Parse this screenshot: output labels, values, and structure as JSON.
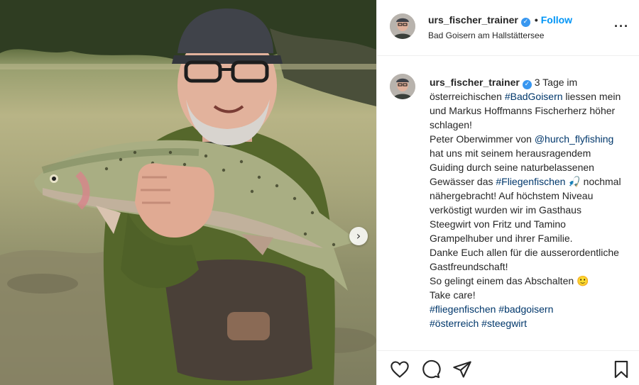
{
  "post": {
    "username": "urs_fischer_trainer",
    "follow_label": "Follow",
    "location": "Bad Goisern am Hallstättersee"
  },
  "caption": {
    "username": "urs_fischer_trainer",
    "line1_text": "3 Tage im österreichischen ",
    "tag1": "#BadGoisern",
    "line1_rest": " liessen mein und Markus Hoffmanns Fischerherz höher schlagen!",
    "line2_text": "Peter Oberwimmer von",
    "mention": "@hurch_flyfishing",
    "line2_rest": " hat uns mit seinem herausragendem Guiding durch seine naturbelassenen Gewässer das",
    "tag2": "#Fliegenfischen",
    "emoji1": "🎣",
    "line3_rest": " nochmal nähergebracht! Auf höchstem Niveau verköstigt wurden wir im Gasthaus Steegwirt von Fritz und Tamino Grampelhuber und ihrer Familie.",
    "line4": "Danke Euch allen für die ausserordentliche Gastfreundschaft!",
    "line5": "So gelingt einem das Abschalten",
    "emoji2": "🙂",
    "line6": "Take care!",
    "hashtags_line1_a": "#fliegenfischen",
    "hashtags_line1_b": "#badgoisern",
    "hashtags_line2_a": "#österreich",
    "hashtags_line2_b": "#steegwirt"
  },
  "icons": {
    "verified": "verified-badge-icon",
    "more": "more-options-icon",
    "like": "heart-icon",
    "comment": "comment-icon",
    "share": "paper-plane-icon",
    "save": "bookmark-icon",
    "next": "chevron-right-icon"
  },
  "colors": {
    "link": "#0095f6",
    "hashtag": "#00376b",
    "verified": "#3897f0"
  }
}
